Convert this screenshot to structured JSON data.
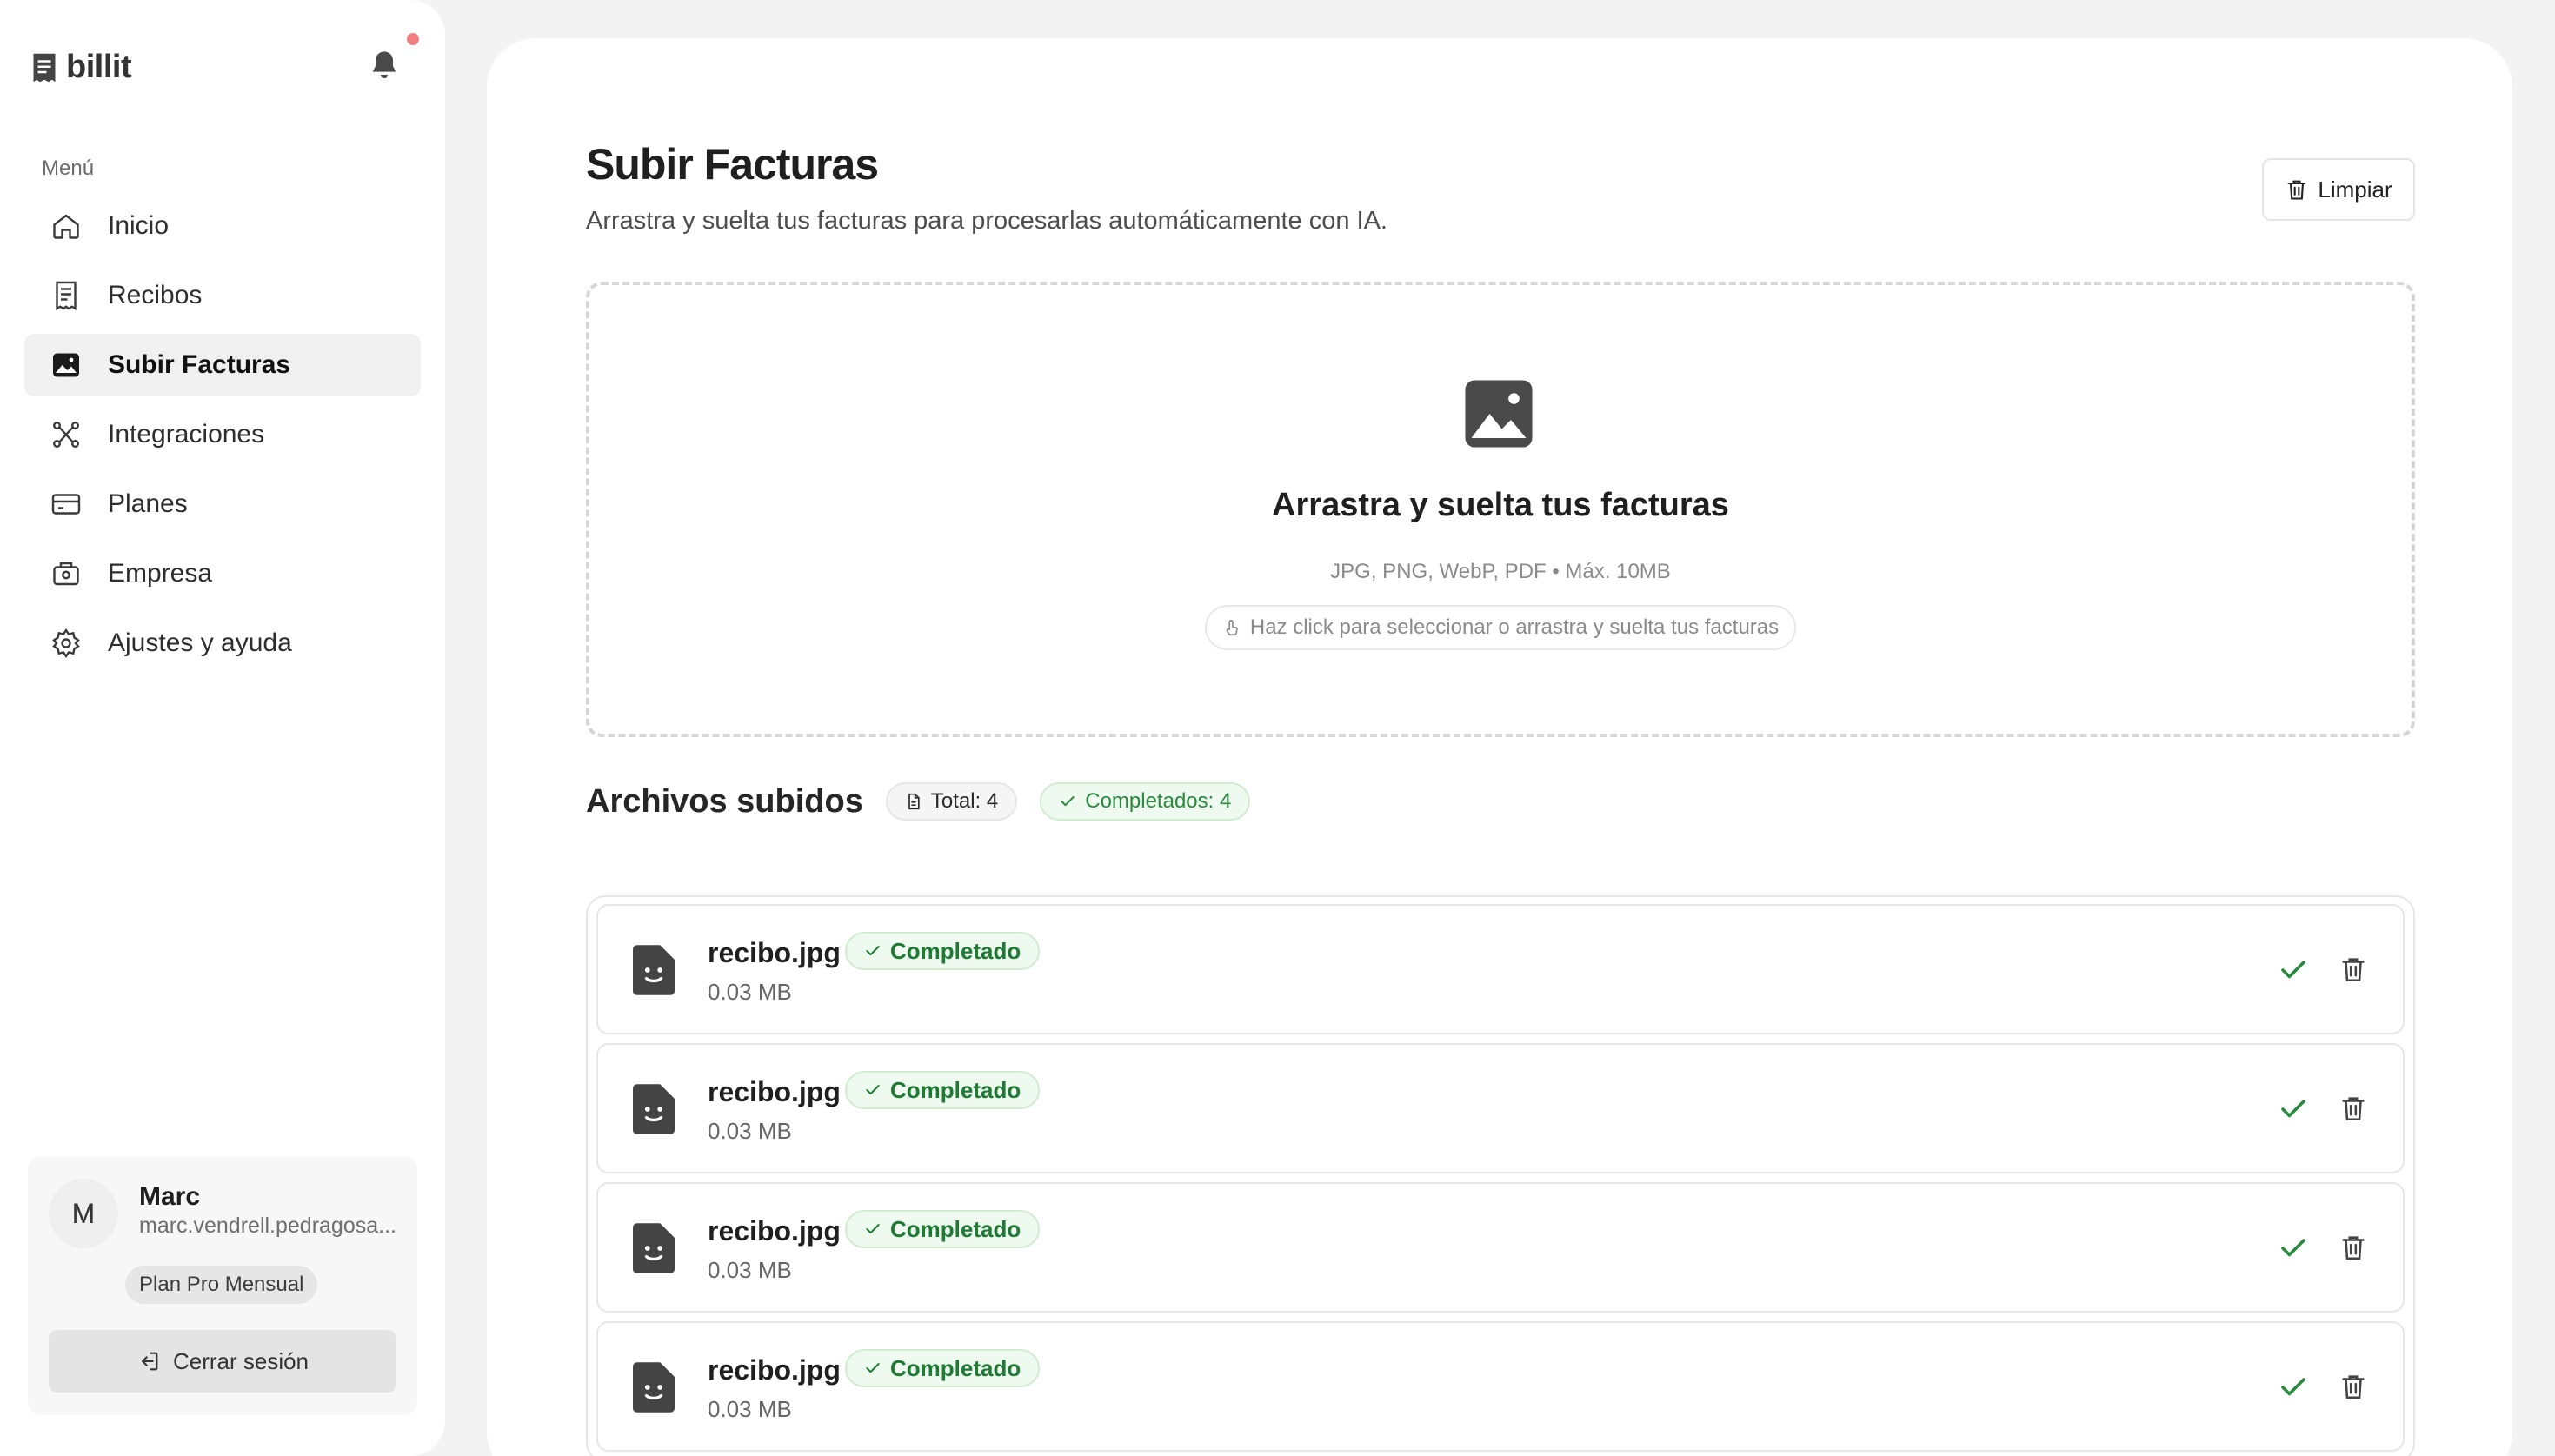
{
  "brand": {
    "name": "billit"
  },
  "sidebar": {
    "menu_label": "Menú",
    "items": [
      {
        "label": "Inicio",
        "icon": "home-icon"
      },
      {
        "label": "Recibos",
        "icon": "receipt-icon"
      },
      {
        "label": "Subir Facturas",
        "icon": "image-icon"
      },
      {
        "label": "Integraciones",
        "icon": "integrations-icon"
      },
      {
        "label": "Planes",
        "icon": "card-icon"
      },
      {
        "label": "Empresa",
        "icon": "briefcase-icon"
      },
      {
        "label": "Ajustes y ayuda",
        "icon": "gear-icon"
      }
    ]
  },
  "user": {
    "initial": "M",
    "name": "Marc",
    "email": "marc.vendrell.pedragosa...",
    "plan": "Plan Pro Mensual",
    "logout_label": "Cerrar sesión"
  },
  "header": {
    "title": "Subir Facturas",
    "subtitle": "Arrastra y suelta tus facturas para procesarlas automáticamente con IA.",
    "clear_label": "Limpiar"
  },
  "dropzone": {
    "title": "Arrastra y suelta tus facturas",
    "formats": "JPG, PNG, WebP, PDF • Máx. 10MB",
    "hint": "Haz click para seleccionar o arrastra y suelta tus facturas"
  },
  "files": {
    "title": "Archivos subidos",
    "total_label": "Total: 4",
    "completed_label": "Completados: 4",
    "items": [
      {
        "name": "recibo.jpg",
        "size": "0.03 MB",
        "status": "Completado"
      },
      {
        "name": "recibo.jpg",
        "size": "0.03 MB",
        "status": "Completado"
      },
      {
        "name": "recibo.jpg",
        "size": "0.03 MB",
        "status": "Completado"
      },
      {
        "name": "recibo.jpg",
        "size": "0.03 MB",
        "status": "Completado"
      }
    ]
  },
  "colors": {
    "accent_green": "#2c8a3e",
    "badge_green_bg": "#eef9ef",
    "notification_dot": "#f08080"
  }
}
